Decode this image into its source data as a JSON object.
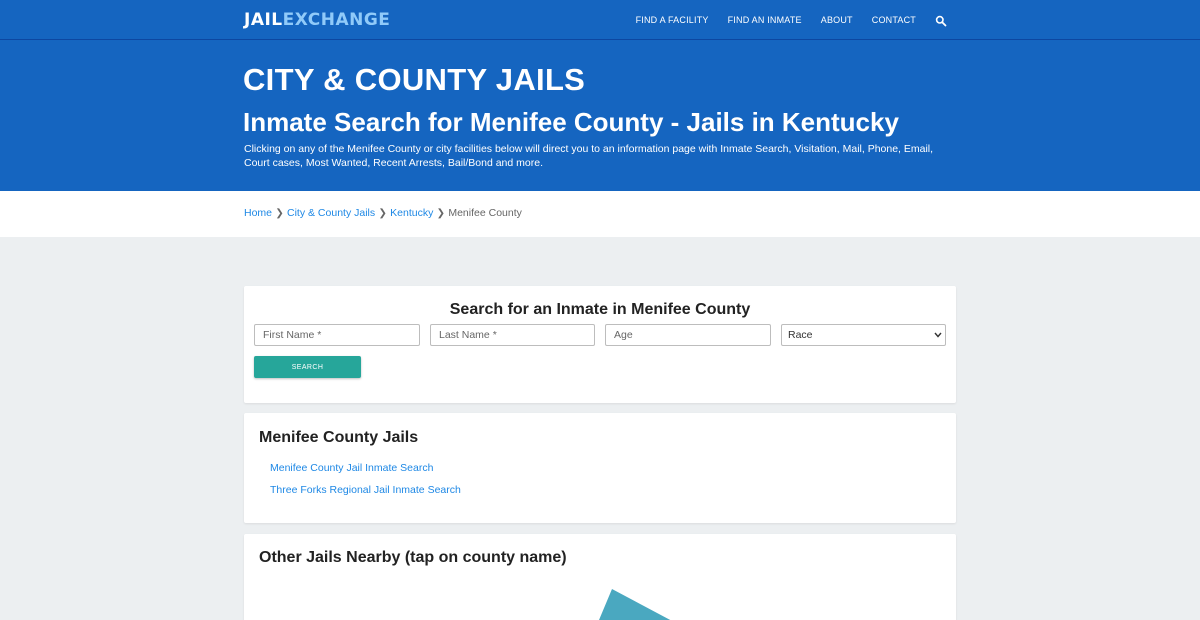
{
  "colors": {
    "brand_blue": "#1565c0",
    "link_blue": "#1e88e5",
    "button_teal": "#26a69a",
    "page_bg": "#eceff1",
    "map_teal": "#4aa8c0"
  },
  "nav": {
    "logo_part1": "JAIL",
    "logo_part2": "EXCHANGE",
    "links": [
      "FIND A FACILITY",
      "FIND AN INMATE",
      "ABOUT",
      "CONTACT"
    ],
    "search_icon": "search-icon"
  },
  "hero": {
    "category": "CITY & COUNTY JAILS",
    "title": "Inmate Search for Menifee County - Jails in Kentucky",
    "description": "Clicking on any of the Menifee County or city facilities below will direct you to an information page with Inmate Search, Visitation, Mail, Phone, Email, Court cases, Most Wanted, Recent Arrests, Bail/Bond and more."
  },
  "breadcrumb": {
    "items": [
      "Home",
      "City & County Jails",
      "Kentucky"
    ],
    "current": "Menifee County"
  },
  "search_form": {
    "title": "Search for an Inmate in Menifee County",
    "first_name_placeholder": "First Name *",
    "last_name_placeholder": "Last Name *",
    "age_placeholder": "Age",
    "race_selected": "Race",
    "button_label": "SEARCH"
  },
  "jails": {
    "heading": "Menifee County Jails",
    "links": [
      "Menifee County Jail Inmate Search",
      "Three Forks Regional Jail Inmate Search"
    ]
  },
  "nearby": {
    "heading": "Other Jails Nearby (tap on county name)"
  }
}
